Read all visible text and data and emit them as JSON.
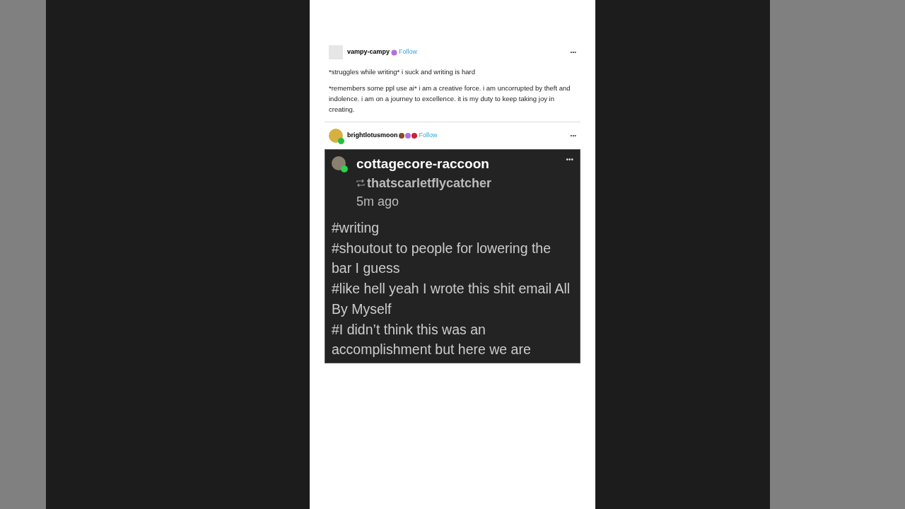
{
  "post": {
    "author": "vampy-campy",
    "follow": "Follow",
    "more": "•••",
    "paragraphs": [
      "*struggles while writing* i suck and writing is hard",
      "*remembers some ppl use ai* i am a creative force. i am uncorrupted by theft and indolence. i am on a journey to excellence. it is my duty to keep taking joy in creating."
    ]
  },
  "reblog": {
    "author": "brightlotusmoon",
    "badges": [
      {
        "color": "#8a4a2a"
      },
      {
        "color": "#b070e0"
      },
      {
        "color": "#d02030"
      }
    ],
    "follow": "Follow",
    "more": "•••",
    "screenshot": {
      "author": "cottagecore-raccoon",
      "reblogged_from": "thatscarletflycatcher",
      "time": "5m ago",
      "more": "•••",
      "tags": [
        "#writing",
        "#shoutout to people for lowering the bar I guess",
        "#like hell yeah I wrote this shit email All By Myself",
        "#I didn’t think this was an accomplishment but here we are"
      ]
    }
  }
}
